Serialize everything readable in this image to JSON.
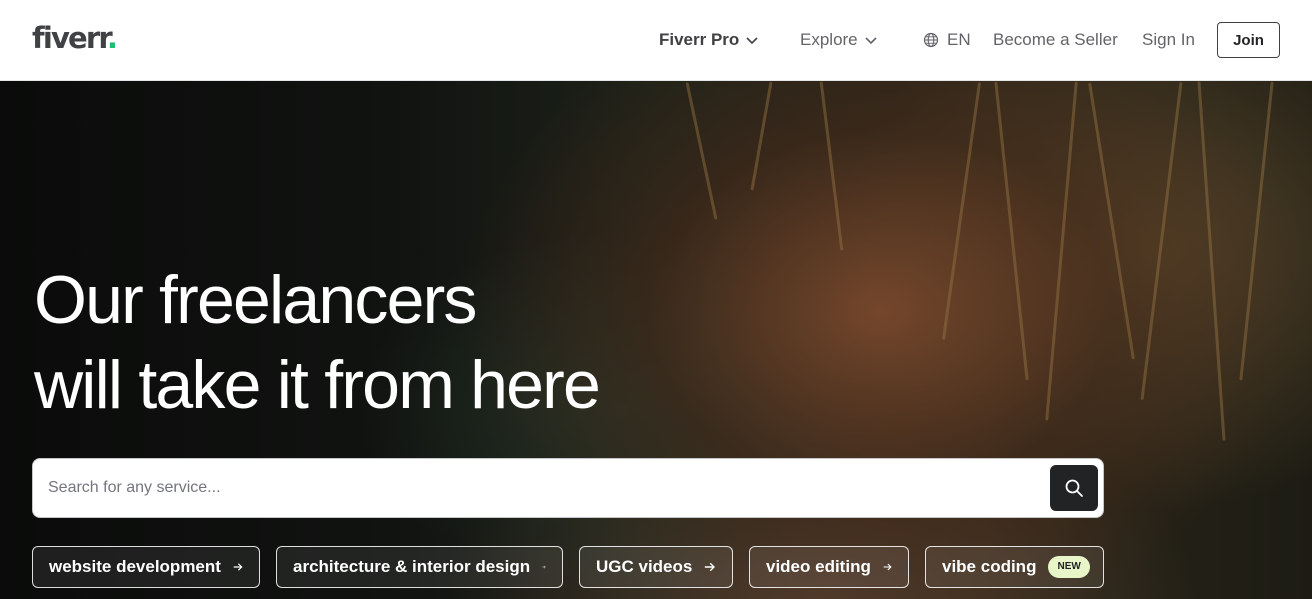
{
  "header": {
    "logo_text": "fiverr",
    "logo_dot": ".",
    "nav": {
      "fiverr_pro": "Fiverr Pro",
      "explore": "Explore",
      "language": "EN",
      "become_seller": "Become a Seller",
      "sign_in": "Sign In"
    },
    "join_label": "Join"
  },
  "hero": {
    "headline_line1": "Our freelancers",
    "headline_line2": "will take it from here",
    "search": {
      "placeholder": "Search for any service...",
      "value": ""
    },
    "chips": [
      {
        "label": "website development"
      },
      {
        "label": "architecture & interior design"
      },
      {
        "label": "UGC videos"
      },
      {
        "label": "video editing"
      },
      {
        "label": "vibe coding",
        "badge": "NEW"
      }
    ]
  },
  "colors": {
    "brand_green": "#1dbf73",
    "text_dark": "#404145",
    "search_button": "#222325",
    "new_badge": "#e8f5c8"
  },
  "icons": [
    "chevron-down-icon",
    "globe-icon",
    "search-icon",
    "arrow-right-icon"
  ]
}
